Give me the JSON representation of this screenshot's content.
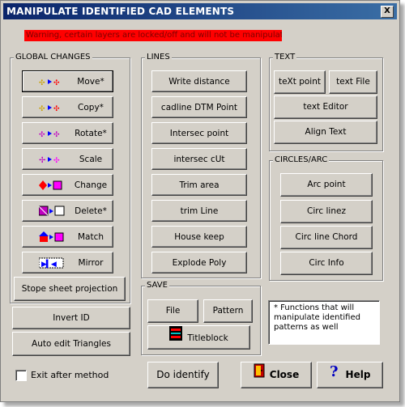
{
  "window": {
    "title": "MANIPULATE IDENTIFIED CAD ELEMENTS",
    "close_glyph": "X"
  },
  "warning": "Warning, certain layers are locked/off and will not be manipulated.",
  "global_changes": {
    "caption": "GLOBAL CHANGES",
    "items": [
      {
        "label": "Move*",
        "icon": "move-icon"
      },
      {
        "label": "Copy*",
        "icon": "copy-icon"
      },
      {
        "label": "Rotate*",
        "icon": "rotate-icon"
      },
      {
        "label": "Scale",
        "icon": "scale-icon"
      },
      {
        "label": "Change",
        "icon": "change-icon"
      },
      {
        "label": "Delete*",
        "icon": "delete-icon"
      },
      {
        "label": "Match",
        "icon": "match-icon"
      },
      {
        "label": "Mirror",
        "icon": "mirror-icon"
      }
    ],
    "stope_label": "Stope sheet projection"
  },
  "lines": {
    "caption": "LINES",
    "items": [
      "Write distance",
      "cadline DTM Point",
      "Intersec point",
      "intersec cUt",
      "Trim area",
      "trim Line",
      "House keep",
      "Explode Poly"
    ]
  },
  "text": {
    "caption": "TEXT",
    "text_point": "teXt point",
    "text_file": "text File",
    "text_editor": "text Editor",
    "align_text": "Align Text"
  },
  "circles": {
    "caption": "CIRCLES/ARC",
    "items": [
      "Arc point",
      "Circ linez",
      "Circ line Chord",
      "Circ Info"
    ]
  },
  "save": {
    "caption": "SAVE",
    "file": "File",
    "pattern": "Pattern",
    "titleblock": "Titleblock"
  },
  "invert_id": "Invert ID",
  "auto_edit": "Auto edit Triangles",
  "note": "*  Functions that will manipulate  identified patterns as well",
  "exit_after": "Exit after method",
  "do_identify": "Do identify",
  "close": "Close",
  "help": "Help"
}
